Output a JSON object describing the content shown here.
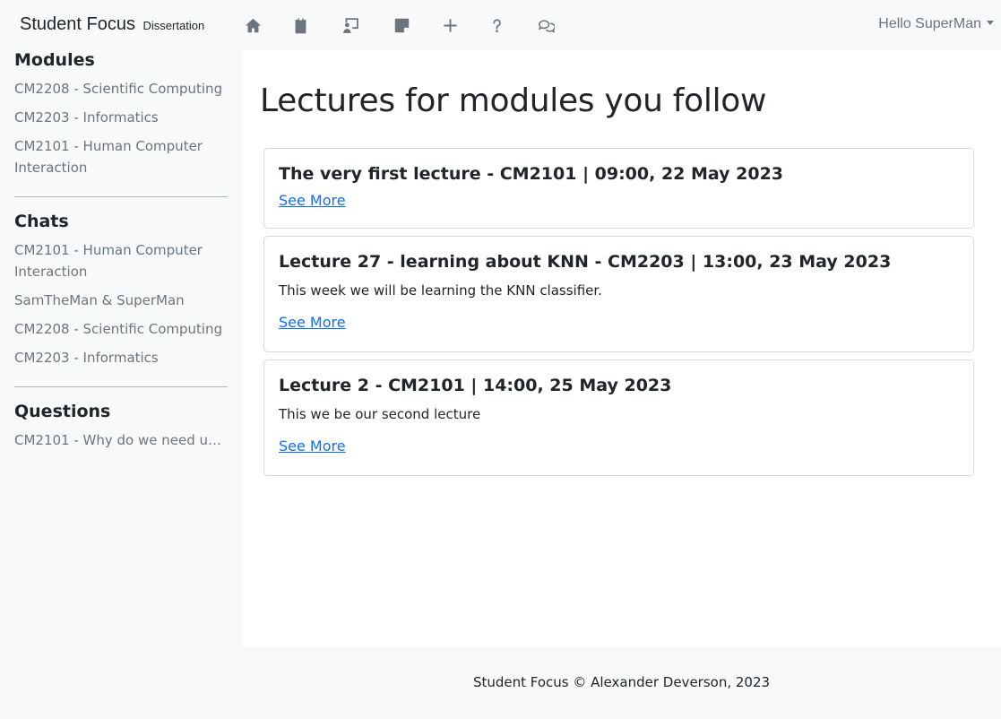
{
  "navbar": {
    "brand": "Student Focus",
    "brand_sub": "Dissertation",
    "user_greeting": "Hello SuperMan",
    "icons": [
      "home-icon",
      "clipboard-icon",
      "lecture-board-icon",
      "sticky-note-icon",
      "plus-icon",
      "question-icon",
      "chats-icon"
    ]
  },
  "sidebar": {
    "modules_heading": "Modules",
    "modules": [
      "CM2208 - Scientific Computing",
      "CM2203 - Informatics",
      "CM2101 - Human Computer Interaction"
    ],
    "chats_heading": "Chats",
    "chats": [
      "CM2101 - Human Computer Interaction",
      "SamTheMan & SuperMan",
      "CM2208 - Scientific Computing",
      "CM2203 - Informatics"
    ],
    "questions_heading": "Questions",
    "questions": [
      "CM2101 - Why do we need use..."
    ]
  },
  "main": {
    "title": "Lectures for modules you follow",
    "lectures": [
      {
        "title": "The very first lecture - CM2101 | 09:00, 22 May 2023",
        "description": "",
        "link": "See More"
      },
      {
        "title": "Lecture 27 - learning about KNN - CM2203 | 13:00, 23 May 2023",
        "description": "This week we will be learning the KNN classifier.",
        "link": "See More"
      },
      {
        "title": "Lecture 2 - CM2101 | 14:00, 25 May 2023",
        "description": "This we be our second lecture",
        "link": "See More"
      }
    ]
  },
  "footer": {
    "text": "Student Focus © Alexander Deverson, 2023"
  },
  "colors": {
    "link": "#0d6efd",
    "muted": "#6c757d",
    "page_bg": "#f8f9fa",
    "main_bg": "#ffffff"
  }
}
